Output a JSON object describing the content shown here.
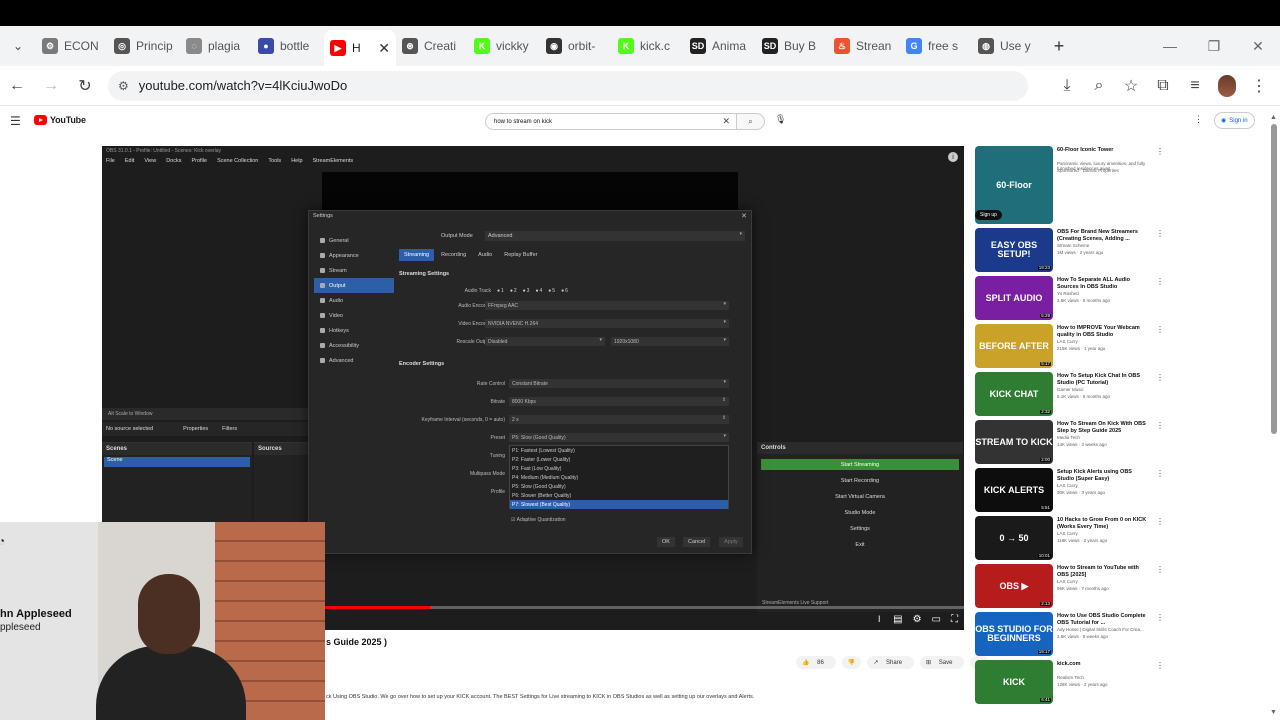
{
  "browser": {
    "tabs": [
      {
        "label": "ECON",
        "color": "#7a7a7a",
        "glyph": "⚙"
      },
      {
        "label": "Princip",
        "color": "#555555",
        "glyph": "◎"
      },
      {
        "label": "plagia",
        "color": "#8a8a8a",
        "glyph": "◌"
      },
      {
        "label": "bottle",
        "color": "#3a4aa8",
        "glyph": "●"
      },
      {
        "label": "H",
        "color": "#ff0000",
        "glyph": "▶",
        "active": true
      },
      {
        "label": "Creati",
        "color": "#555555",
        "glyph": "⊛"
      },
      {
        "label": "vickky",
        "color": "#53fc18",
        "glyph": "K"
      },
      {
        "label": "orbit-",
        "color": "#333333",
        "glyph": "◉"
      },
      {
        "label": "kick.c",
        "color": "#53fc18",
        "glyph": "K"
      },
      {
        "label": "Anima",
        "color": "#222222",
        "glyph": "SD"
      },
      {
        "label": "Buy B",
        "color": "#222222",
        "glyph": "SD"
      },
      {
        "label": "Strean",
        "color": "#e8552e",
        "glyph": "♨"
      },
      {
        "label": "free s",
        "color": "#4285f4",
        "glyph": "G"
      },
      {
        "label": "Use y",
        "color": "#555555",
        "glyph": "◍"
      }
    ],
    "new_tab": "+",
    "url": "youtube.com/watch?v=4lKciuJwoDo"
  },
  "youtube": {
    "logo_text": "YouTube",
    "search_value": "how to stream on kick",
    "sign_in": "Sign in",
    "video_title_fragment": "s Guide 2025 )",
    "likes": "86",
    "share": "Share",
    "save": "Save",
    "description": "ck Using OBS Studio. We go over how to set up your KICK account. The BEST Settings for Live streaming to KICK in OBS Studios as well as setting up our overlays and Alerts."
  },
  "obs": {
    "window_title": "OBS 31.0.1 - Profile: Untitled - Scenes: Kick overlay",
    "menu": [
      "File",
      "Edit",
      "View",
      "Docks",
      "Profile",
      "Scene Collection",
      "Tools",
      "Help",
      "StreamElements"
    ],
    "source_bar": "Alt     Scale to Window",
    "no_source": "No source selected",
    "properties": "Properties",
    "filters": "Filters",
    "scenes_title": "Scenes",
    "scene_item": "Scene",
    "sources_title": "Sources",
    "controls_title": "Controls",
    "controls": [
      "Start Streaming",
      "Start Recording",
      "Start Virtual Camera",
      "Studio Mode",
      "Settings",
      "Exit"
    ],
    "status_bar": "StreamElements Live Support",
    "settings": {
      "title": "Settings",
      "nav": [
        "General",
        "Appearance",
        "Stream",
        "Output",
        "Audio",
        "Video",
        "Hotkeys",
        "Accessibility",
        "Advanced"
      ],
      "active_nav": "Output",
      "output_mode_label": "Output Mode",
      "output_mode_value": "Advanced",
      "tabs": [
        "Streaming",
        "Recording",
        "Audio",
        "Replay Buffer"
      ],
      "streaming_settings_title": "Streaming Settings",
      "audio_track_label": "Audio Track",
      "audio_tracks": [
        "1",
        "2",
        "3",
        "4",
        "5",
        "6"
      ],
      "audio_encoder_label": "Audio Encoder",
      "audio_encoder_value": "FFmpeg AAC",
      "video_encoder_label": "Video Encoder",
      "video_encoder_value": "NVIDIA NVENC H.264",
      "rescale_label": "Rescale Output",
      "rescale_value": "Disabled",
      "rescale_res": "1920x1080",
      "encoder_settings_title": "Encoder Settings",
      "rate_control_label": "Rate Control",
      "rate_control_value": "Constant Bitrate",
      "bitrate_label": "Bitrate",
      "bitrate_value": "8000 Kbps",
      "keyframe_label": "Keyframe Interval (seconds, 0 = auto)",
      "keyframe_value": "2 s",
      "preset_label": "Preset",
      "preset_value": "P5: Slow (Good Quality)",
      "tuning_label": "Tuning",
      "multipass_label": "Multipass Mode",
      "profile_label": "Profile",
      "preset_options": [
        "P1: Fastest (Lowest Quality)",
        "P2: Faster (Lower Quality)",
        "P3: Fast (Low Quality)",
        "P4: Medium (Medium Quality)",
        "P5: Slow (Good Quality)",
        "P6: Slower (Better Quality)",
        "P7: Slowest (Best Quality)"
      ],
      "preset_selected_index": 6,
      "adaptive_quant": "Adaptive Quantization",
      "ok": "OK",
      "cancel": "Cancel",
      "apply": "Apply"
    }
  },
  "webcam": {
    "name": "hn Appleseed",
    "handle": "ppleseed"
  },
  "recommendations": [
    {
      "title": "60-Floor Iconic Tower",
      "channel": "Panoramic views, luxury amenities, and fully furnished residences await.",
      "meta": "Sponsored · Damac Properties",
      "thumb_text": "60-Floor",
      "color": "#1f6f7a",
      "duration": "",
      "ad": true,
      "cta": "Sign up"
    },
    {
      "title": "OBS For Brand New Streamers (Creating Scenes, Adding ...",
      "channel": "Stream Scheme",
      "meta": "1M views · 2 years ago",
      "thumb_text": "EASY OBS SETUP!",
      "color": "#1b3a8c",
      "duration": "18:23"
    },
    {
      "title": "How To Separate ALL Audio Sources In OBS Studio",
      "channel": "Yo Rashed",
      "meta": "2.6K views · 5 months ago",
      "thumb_text": "SPLIT AUDIO",
      "color": "#7a1fa2",
      "duration": "5:29"
    },
    {
      "title": "How to IMPROVE Your Webcam quality in OBS Studio",
      "channel": "LAS Curry",
      "meta": "215K views · 1 year ago",
      "thumb_text": "BEFORE  AFTER",
      "color": "#c9a227",
      "duration": "5:17"
    },
    {
      "title": "How To Setup Kick Chat In OBS Studio (PC Tutorial)",
      "channel": "Gamer Music",
      "meta": "5.1K views · 6 months ago",
      "thumb_text": "KICK CHAT",
      "color": "#2e7d32",
      "duration": "2:32"
    },
    {
      "title": "How To Stream On Kick With OBS Step by Step Guide 2025",
      "channel": "Media Tech",
      "meta": "14K views · 3 weeks ago",
      "thumb_text": "STREAM TO KICK",
      "color": "#333333",
      "duration": "2:00"
    },
    {
      "title": "Setup Kick Alerts using OBS Studio (Super Easy)",
      "channel": "LAS Curry",
      "meta": "30K views · 3 years ago",
      "thumb_text": "KICK ALERTS",
      "color": "#0d0d0d",
      "duration": "5:51"
    },
    {
      "title": "10 Hacks to Grow From 0 on KICK (Works Every Time)",
      "channel": "LAS Curry",
      "meta": "118K views · 2 years ago",
      "thumb_text": "0 → 50",
      "color": "#1a1a1a",
      "duration": "10:01"
    },
    {
      "title": "How to Stream to YouTube with OBS [2025]",
      "channel": "LAS Curry",
      "meta": "56K views · 7 months ago",
      "thumb_text": "OBS ▶",
      "color": "#b71c1c",
      "duration": "2:13"
    },
    {
      "title": "How to Use OBS Studio Complete OBS Tutorial for ...",
      "channel": "Ady Hosse | Digital Skills Coach For Crea...",
      "meta": "2.6K views · 5 weeks ago",
      "thumb_text": "OBS STUDIO FOR BEGINNERS",
      "color": "#1565c0",
      "duration": "19:17"
    },
    {
      "title": "kick.com",
      "channel": "Realism Tech",
      "meta": "128K views · 2 years ago",
      "thumb_text": "KICK",
      "color": "#2e7d32",
      "duration": "6:41"
    }
  ]
}
